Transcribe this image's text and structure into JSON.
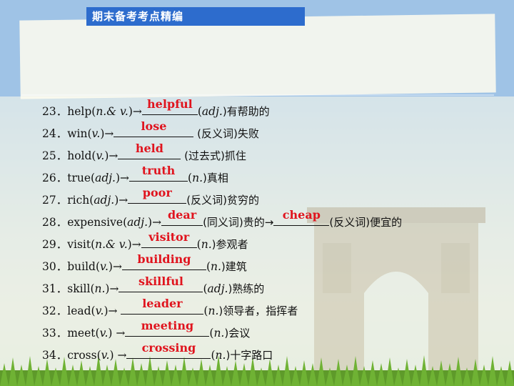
{
  "header": {
    "title": "期末备考考点精编"
  },
  "items": [
    {
      "num": "23．",
      "pre": "help(",
      "pos": "n.& v.",
      "mid": ")→",
      "answer": "helpful",
      "post_pos": "adj.",
      "post": ")有帮助的"
    },
    {
      "num": "24．",
      "pre": "win(",
      "pos": "v.",
      "mid": ")→",
      "answer": "lose",
      "post": " (反义词)失败"
    },
    {
      "num": "25．",
      "pre": "hold(",
      "pos": "v.",
      "mid": ")→",
      "answer": "held",
      "post": " (过去式)抓住"
    },
    {
      "num": "26．",
      "pre": "true(",
      "pos": "adj.",
      "mid": ")→",
      "answer": "truth",
      "post_pos": "n.",
      "post": ")真相"
    },
    {
      "num": "27．",
      "pre": "rich(",
      "pos": "adj.",
      "mid": ")→",
      "answer": "poor",
      "post": "(反义词)贫穷的"
    },
    {
      "num": "28．",
      "pre": "expensive(",
      "pos": "adj.",
      "mid": ")→",
      "answer": "dear",
      "post": "(同义词)贵的→",
      "answer2": "cheap",
      "post2": "(反义词)便宜的"
    },
    {
      "num": "29．",
      "pre": "visit(",
      "pos": "n.& v.",
      "mid": ")→",
      "answer": "visitor",
      "post_pos": "n.",
      "post": ")参观者"
    },
    {
      "num": "30．",
      "pre": "build(",
      "pos": "v.",
      "mid": ")→",
      "answer": "building",
      "post_pos": "n.",
      "post": ")建筑"
    },
    {
      "num": "31．",
      "pre": "skill(",
      "pos": "n.",
      "mid": ")→",
      "answer": "skillful",
      "post_pos": "adj.",
      "post": ")熟练的"
    },
    {
      "num": "32．",
      "pre": "lead(",
      "pos": "v.",
      "mid": ")→ ",
      "answer": "leader",
      "post_pos": "n.",
      "post": ")领导者，指挥者"
    },
    {
      "num": "33．",
      "pre": "meet(",
      "pos": "v.",
      "mid": ") →",
      "answer": "meeting",
      "post_pos": "n.",
      "post": ")会议"
    },
    {
      "num": "34．",
      "pre": "cross(",
      "pos": "v.",
      "mid": ") →",
      "answer": "crossing",
      "post_pos": "n.",
      "post": ")十字路口"
    }
  ]
}
